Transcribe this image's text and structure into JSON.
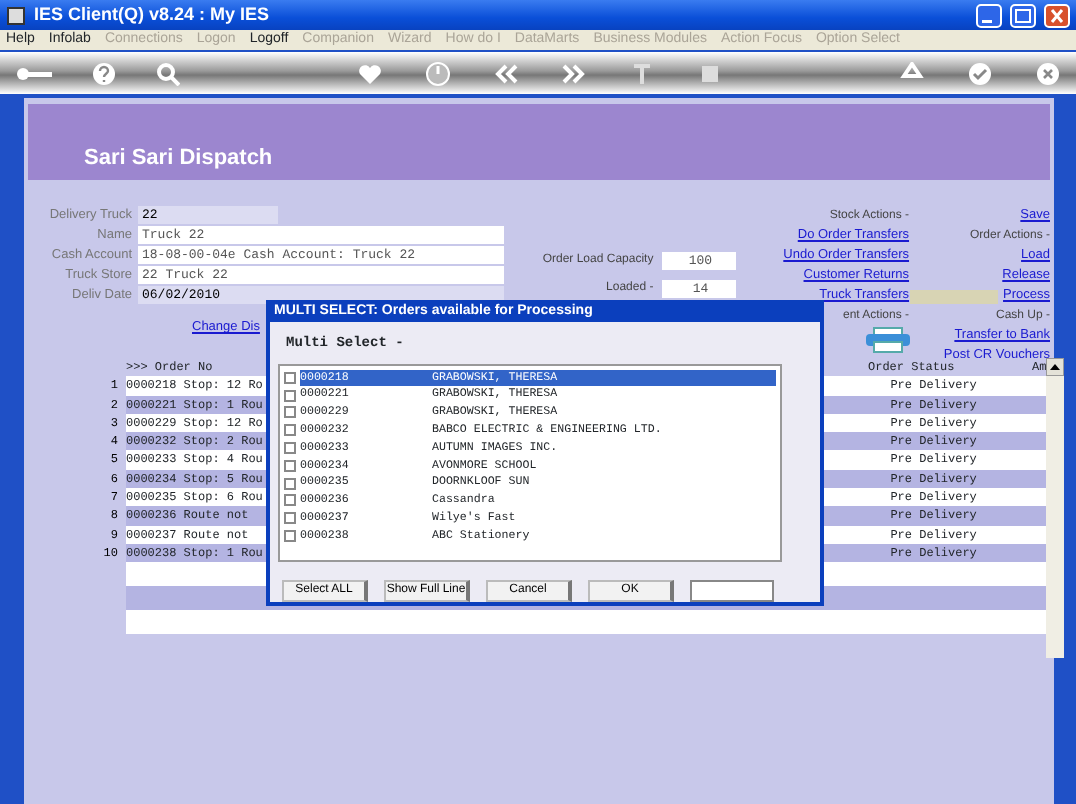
{
  "window": {
    "title": "IES Client(Q) v8.24 : My IES"
  },
  "menu": [
    {
      "label": "Help",
      "disabled": false
    },
    {
      "label": "Infolab",
      "disabled": false
    },
    {
      "label": "Connections",
      "disabled": true
    },
    {
      "label": "Logon",
      "disabled": true
    },
    {
      "label": "Logoff",
      "disabled": false
    },
    {
      "label": "Companion",
      "disabled": true
    },
    {
      "label": "Wizard",
      "disabled": true
    },
    {
      "label": "How do I",
      "disabled": true
    },
    {
      "label": "DataMarts",
      "disabled": true
    },
    {
      "label": "Business Modules",
      "disabled": true
    },
    {
      "label": "Action Focus",
      "disabled": true
    },
    {
      "label": "Option Select",
      "disabled": true
    }
  ],
  "page": {
    "title": "Sari Sari Dispatch"
  },
  "form": {
    "fields": [
      {
        "label": "Delivery Truck",
        "value": "22",
        "disabled": false,
        "kind": "short"
      },
      {
        "label": "Name",
        "value": "Truck 22",
        "disabled": true,
        "kind": "wide"
      },
      {
        "label": "Cash Account",
        "value": "18-08-00-04e Cash Account: Truck 22",
        "disabled": true,
        "kind": "wide"
      },
      {
        "label": "Truck Store",
        "value": "22 Truck 22",
        "disabled": true,
        "kind": "wide"
      },
      {
        "label": "Deliv Date",
        "value": "06/02/2010",
        "disabled": false,
        "kind": "wide"
      }
    ],
    "change_link": "Change Dis"
  },
  "capacity": {
    "fields": [
      {
        "label": "Order Load Capacity",
        "value": "100"
      },
      {
        "label": "Loaded -",
        "value": "14"
      }
    ]
  },
  "stock_actions": {
    "heading": "Stock Actions -",
    "links": [
      "Do Order Transfers",
      "Undo Order Transfers",
      "Customer Returns",
      "Truck Transfers"
    ],
    "heading_2": "ent Actions -"
  },
  "order_actions": {
    "save": "Save",
    "heading": "Order Actions -",
    "links": [
      {
        "label": "Load",
        "highlighted": false
      },
      {
        "label": "Release",
        "highlighted": false
      },
      {
        "label": "Process",
        "highlighted": true
      }
    ]
  },
  "cash_up": {
    "heading": "Cash Up -",
    "links": [
      "Transfer to Bank",
      "Post CR Vouchers"
    ]
  },
  "table": {
    "columns": [
      ">>> Order No",
      "Order Status",
      "Am"
    ],
    "rows": [
      {
        "number": "1",
        "order": "0000218 Stop: 12 Ro",
        "status": "Pre Delivery"
      },
      {
        "number": "2",
        "order": "0000221 Stop: 1 Rou",
        "status": "Pre Delivery"
      },
      {
        "number": "3",
        "order": "0000229 Stop: 12 Ro",
        "status": "Pre Delivery"
      },
      {
        "number": "4",
        "order": "0000232 Stop: 2 Rou",
        "status": "Pre Delivery"
      },
      {
        "number": "5",
        "order": "0000233 Stop: 4 Rou",
        "status": "Pre Delivery"
      },
      {
        "number": "6",
        "order": "0000234 Stop: 5 Rou",
        "status": "Pre Delivery"
      },
      {
        "number": "7",
        "order": "0000235 Stop: 6 Rou",
        "status": "Pre Delivery"
      },
      {
        "number": "8",
        "order": "0000236 Route not",
        "status": "Pre Delivery"
      },
      {
        "number": "9",
        "order": "0000237 Route not",
        "status": "Pre Delivery"
      },
      {
        "number": "10",
        "order": "0000238 Stop: 1 Rou",
        "status": "Pre Delivery"
      }
    ]
  },
  "dialog": {
    "title": "MULTI SELECT: Orders available for Processing",
    "label": "Multi Select -",
    "items": [
      {
        "code": "0000218",
        "name": "GRABOWSKI, THERESA",
        "checked": false,
        "selected": true
      },
      {
        "code": "0000221",
        "name": "GRABOWSKI, THERESA",
        "checked": false,
        "selected": false
      },
      {
        "code": "0000229",
        "name": "GRABOWSKI, THERESA",
        "checked": false,
        "selected": false
      },
      {
        "code": "0000232",
        "name": "BABCO ELECTRIC & ENGINEERING LTD.",
        "checked": false,
        "selected": false
      },
      {
        "code": "0000233",
        "name": "AUTUMN IMAGES INC.",
        "checked": false,
        "selected": false
      },
      {
        "code": "0000234",
        "name": "AVONMORE SCHOOL",
        "checked": false,
        "selected": false
      },
      {
        "code": "0000235",
        "name": "DOORNKLOOF SUN",
        "checked": false,
        "selected": false
      },
      {
        "code": "0000236",
        "name": "Cassandra",
        "checked": false,
        "selected": false
      },
      {
        "code": "0000237",
        "name": "Wilye's Fast",
        "checked": false,
        "selected": false
      },
      {
        "code": "0000238",
        "name": "ABC Stationery",
        "checked": false,
        "selected": false
      }
    ],
    "buttons": [
      "Select ALL",
      "Show Full Line",
      "Cancel",
      "OK"
    ]
  }
}
